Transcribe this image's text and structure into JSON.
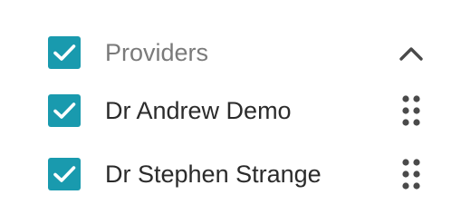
{
  "colors": {
    "checkbox_fill": "#199aae",
    "checkmark": "#ffffff",
    "header_text": "#7a7a7a",
    "item_text": "#2b2b2b",
    "icon": "#4a4a4a"
  },
  "group": {
    "label": "Providers",
    "checked": true,
    "collapse_icon": "chevron-up-icon"
  },
  "providers": [
    {
      "label": "Dr Andrew Demo",
      "checked": true,
      "handle_icon": "drag-handle-icon"
    },
    {
      "label": "Dr Stephen Strange",
      "checked": true,
      "handle_icon": "drag-handle-icon"
    }
  ]
}
